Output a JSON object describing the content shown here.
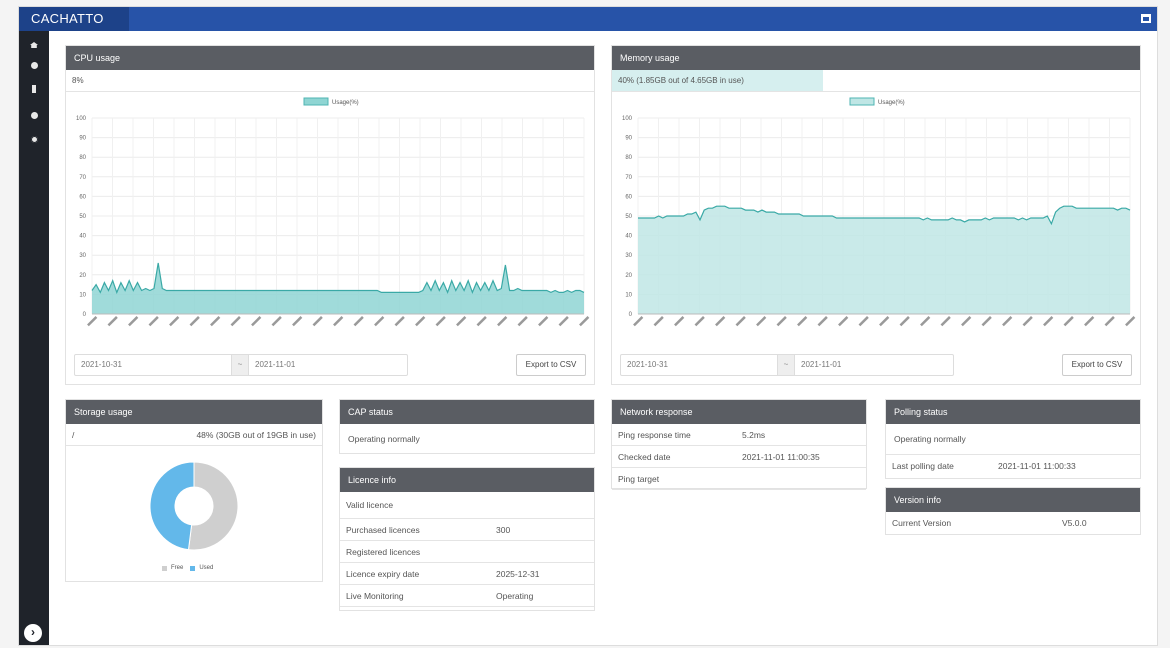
{
  "app": {
    "logo": "CACHATTO"
  },
  "nav": {
    "items": [
      "home",
      "globe",
      "server",
      "question",
      "settings"
    ]
  },
  "cpu": {
    "title": "CPU usage",
    "current": "8%",
    "legend": "Usage(%)",
    "date_from": "2021-10-31",
    "date_sep": "~",
    "date_to": "2021-11-01",
    "export_label": "Export to CSV",
    "yticks": [
      "100",
      "90",
      "80",
      "70",
      "60",
      "50",
      "40",
      "30",
      "20",
      "10",
      "0"
    ]
  },
  "memory": {
    "title": "Memory usage",
    "current": "40% (1.85GB out of 4.65GB in use)",
    "legend": "Usage(%)",
    "date_from": "2021-10-31",
    "date_sep": "~",
    "date_to": "2021-11-01",
    "export_label": "Export to CSV",
    "yticks": [
      "100",
      "90",
      "80",
      "70",
      "60",
      "50",
      "40",
      "30",
      "20",
      "10",
      "0"
    ]
  },
  "storage": {
    "title": "Storage usage",
    "path": "/",
    "usage": "48% (30GB out of 19GB in use)",
    "legend_free": "Free",
    "legend_used": "Used"
  },
  "cap_status": {
    "title": "CAP status",
    "status": "Operating normally"
  },
  "licence": {
    "title": "Licence info",
    "validity": "Valid licence",
    "rows": [
      {
        "label": "Purchased licences",
        "value": "300"
      },
      {
        "label": "Registered licences",
        "value": ""
      },
      {
        "label": "Licence expiry date",
        "value": "2025-12-31"
      },
      {
        "label": "Live Monitoring",
        "value": "Operating"
      }
    ]
  },
  "network": {
    "title": "Network response",
    "rows": [
      {
        "label": "Ping response time",
        "value": "5.2ms"
      },
      {
        "label": "Checked date",
        "value": "2021-11-01 11:00:35"
      },
      {
        "label": "Ping target",
        "value": ""
      }
    ]
  },
  "polling": {
    "title": "Polling status",
    "status": "Operating normally",
    "last_label": "Last polling date",
    "last_value": "2021-11-01 11:00:33"
  },
  "version": {
    "title": "Version info",
    "label": "Current Version",
    "value": "V5.0.0"
  },
  "chart_data": [
    {
      "type": "area",
      "title": "CPU usage",
      "ylim": [
        0,
        100
      ],
      "legend": "top-center",
      "series": [
        {
          "name": "Usage(%)",
          "values": [
            12,
            15,
            11,
            16,
            12,
            17,
            11,
            16,
            12,
            17,
            12,
            16,
            12,
            13,
            12,
            13,
            26,
            13,
            12,
            12,
            12,
            12,
            12,
            12,
            12,
            12,
            12,
            12,
            12,
            12,
            12,
            12,
            12,
            12,
            12,
            12,
            12,
            12,
            12,
            12,
            12,
            12,
            12,
            12,
            12,
            12,
            12,
            12,
            12,
            12,
            12,
            12,
            12,
            12,
            12,
            12,
            12,
            12,
            12,
            12,
            12,
            12,
            12,
            12,
            12,
            12,
            12,
            12,
            12,
            12,
            11,
            11,
            11,
            11,
            11,
            11,
            11,
            11,
            11,
            11,
            12,
            16,
            12,
            17,
            12,
            16,
            11,
            17,
            12,
            16,
            12,
            17,
            11,
            16,
            12,
            16,
            12,
            17,
            12,
            13,
            25,
            12,
            12,
            13,
            12,
            12,
            12,
            12,
            12,
            12,
            12,
            11,
            12,
            11,
            11,
            12,
            11,
            12,
            12,
            11
          ]
        }
      ],
      "color": "#8fd5d3"
    },
    {
      "type": "area",
      "title": "Memory usage",
      "ylim": [
        0,
        100
      ],
      "legend": "top-center",
      "series": [
        {
          "name": "Usage(%)",
          "values": [
            49,
            49,
            49,
            49,
            49,
            50,
            49,
            50,
            50,
            50,
            50,
            50,
            51,
            51,
            52,
            48,
            53,
            54,
            54,
            55,
            55,
            55,
            54,
            54,
            54,
            54,
            53,
            53,
            53,
            52,
            53,
            52,
            52,
            52,
            51,
            51,
            51,
            51,
            51,
            51,
            50,
            50,
            50,
            50,
            50,
            50,
            50,
            50,
            49,
            49,
            49,
            49,
            49,
            49,
            49,
            49,
            49,
            49,
            49,
            49,
            49,
            49,
            49,
            49,
            49,
            49,
            49,
            49,
            49,
            48,
            49,
            48,
            48,
            48,
            48,
            48,
            49,
            48,
            48,
            47,
            48,
            48,
            48,
            48,
            49,
            48,
            49,
            49,
            49,
            49,
            49,
            49,
            48,
            49,
            48,
            49,
            49,
            49,
            49,
            50,
            46,
            52,
            54,
            55,
            55,
            55,
            54,
            54,
            54,
            54,
            54,
            54,
            54,
            54,
            54,
            54,
            53,
            54,
            54,
            53
          ]
        }
      ],
      "color": "#bfe6e5"
    },
    {
      "type": "pie",
      "title": "Storage usage",
      "categories": [
        "Free",
        "Used"
      ],
      "values": [
        52,
        48
      ],
      "colors": [
        "#cfcfcf",
        "#63b8ea"
      ]
    }
  ]
}
